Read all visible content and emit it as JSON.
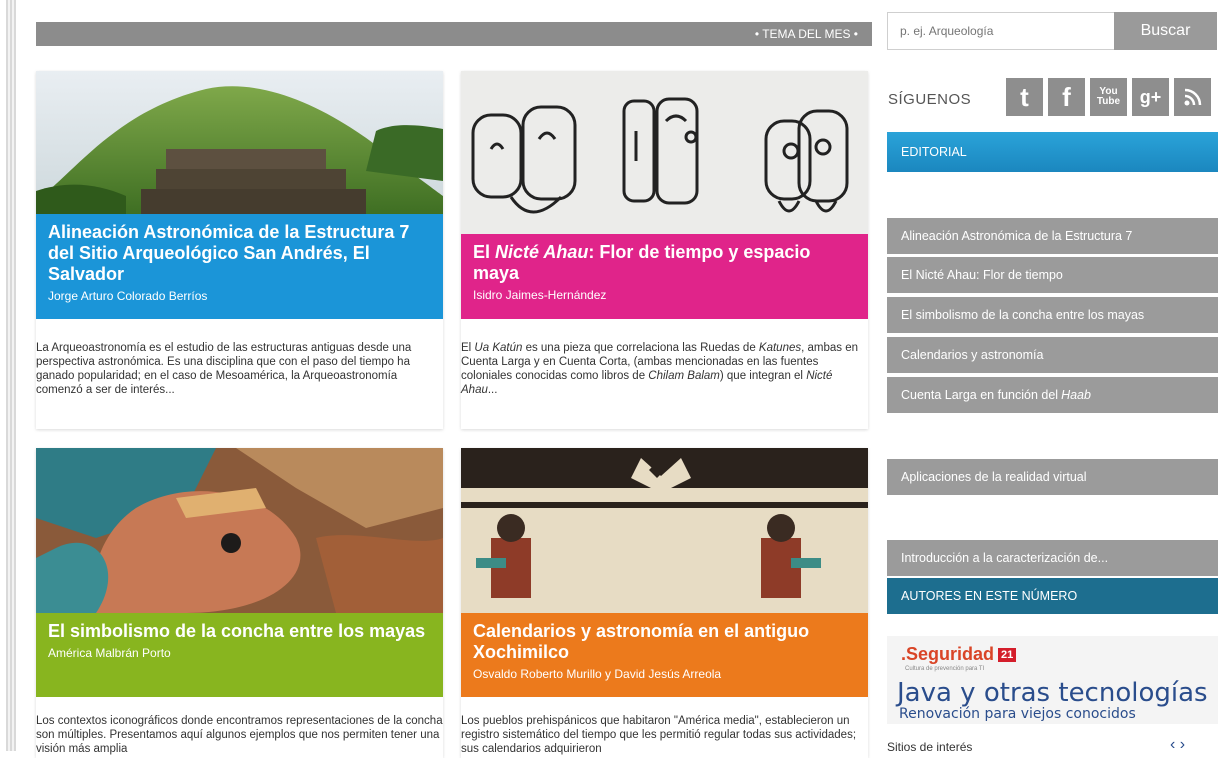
{
  "tema_del_mes": "• TEMA DEL MES •",
  "search": {
    "placeholder": "p. ej. Arqueología",
    "button": "Buscar"
  },
  "follow": {
    "label": "SÍGUENOS",
    "icons": [
      "twitter-icon",
      "facebook-icon",
      "youtube-icon",
      "google-plus-icon",
      "rss-icon"
    ],
    "youtube_text_top": "You",
    "youtube_text_bottom": "Tube",
    "gplus_text": "g+",
    "twitter_text": "t",
    "facebook_text": "f"
  },
  "sidebar": {
    "editorial": "EDITORIAL",
    "links": [
      "Alineación Astronómica de la Estructura 7",
      "El Nicté Ahau: Flor de tiempo",
      "El simbolismo de la concha entre los mayas",
      "Calendarios y astronomía",
      "Cuenta Larga en función del ",
      "Aplicaciones de la realidad virtual",
      "Introducción a la caracterización de..."
    ],
    "link5_italic": "Haab",
    "autores": "AUTORES EN ESTE NÚMERO",
    "sitios": "Sitios de interés",
    "sitios_nav": "‹ ›"
  },
  "ad": {
    "brand": ".Seguridad",
    "badge": "21",
    "tagline": "Cultura de prevención para TI",
    "title": "Java y otras tecnologías",
    "subtitle": "Renovación para viejos conocidos"
  },
  "cards": [
    {
      "title": "Alineación Astronómica de la Estructura 7 del Sitio Arqueológico San Andrés, El Salvador",
      "author": "Jorge Arturo Colorado Berríos",
      "text": "La Arqueoastronomía es el estudio de las estructuras antiguas desde una perspectiva astronómica. Es una disciplina que con el paso del tiempo ha ganado popularidad; en el caso de Mesoamérica, la Arqueoastronomía comenzó a ser de interés...",
      "color": "#1b95d8"
    },
    {
      "title_pre": "El ",
      "title_italic": "Nicté Ahau",
      "title_post": ": Flor de tiempo y espacio maya",
      "author": "Isidro Jaimes-Hernández",
      "text_parts": [
        "El ",
        "Ua Katún",
        " es una pieza que correlaciona las Ruedas de ",
        "Katunes",
        ", ambas en Cuenta Larga y en Cuenta Corta, (ambas mencionadas en las fuentes coloniales conocidas como libros de ",
        "Chilam Balam",
        ") que integran el ",
        "Nicté Ahau",
        "..."
      ],
      "color": "#e0248a"
    },
    {
      "title": "El simbolismo de la concha entre los mayas",
      "author": "América Malbrán Porto",
      "text": "Los contextos iconográficos donde encontramos representaciones de la concha son múltiples. Presentamos aquí algunos ejemplos que nos permiten tener una visión más amplia",
      "color": "#88b51f"
    },
    {
      "title": "Calendarios y astronomía en el antiguo Xochimilco",
      "author": "Osvaldo Roberto Murillo y David Jesús Arreola",
      "text": "Los pueblos prehispánicos que habitaron \"América media\", establecieron un registro sistemático del tiempo que les permitió regular todas sus actividades; sus calendarios adquirieron",
      "color": "#ec7a1c"
    }
  ]
}
